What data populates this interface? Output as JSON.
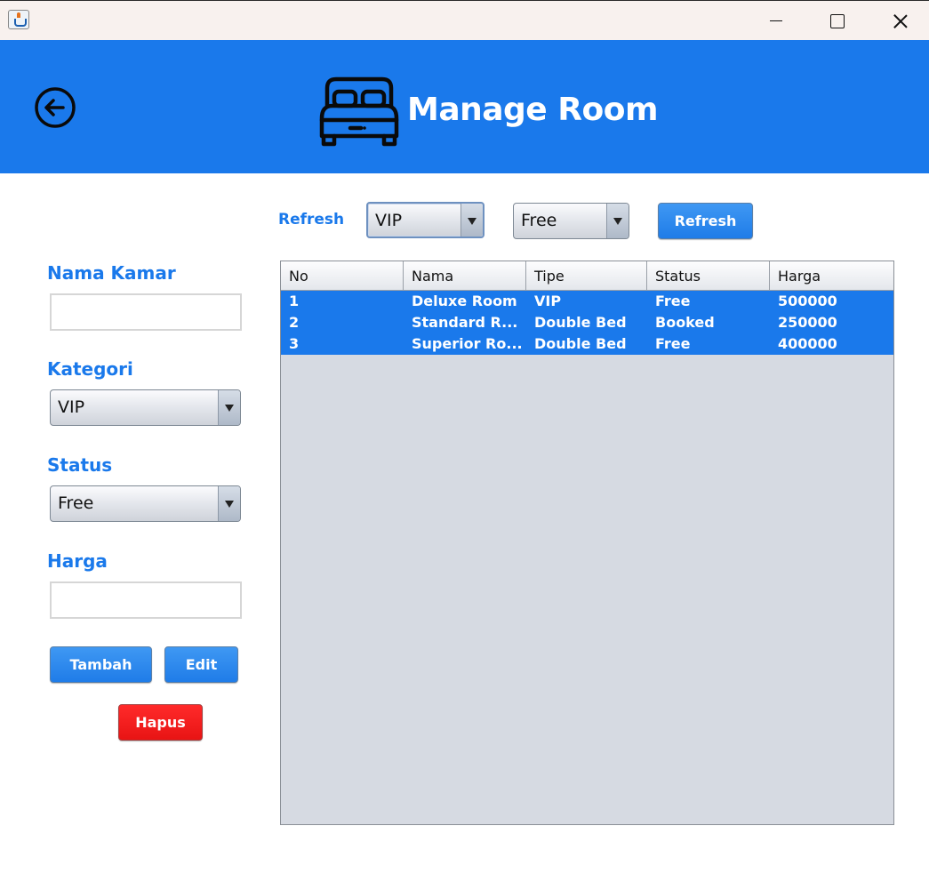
{
  "window": {
    "title": ""
  },
  "header": {
    "title": "Manage Room",
    "back_icon": "arrow-left-circle-icon",
    "bed_icon": "bed-icon"
  },
  "filters": {
    "label": "Refresh",
    "category_selected": "VIP",
    "status_selected": "Free",
    "refresh_button": "Refresh"
  },
  "form": {
    "nama_kamar_label": "Nama Kamar",
    "nama_kamar_value": "",
    "kategori_label": "Kategori",
    "kategori_selected": "VIP",
    "status_label": "Status",
    "status_selected": "Free",
    "harga_label": "Harga",
    "harga_value": "",
    "tambah_button": "Tambah",
    "edit_button": "Edit",
    "hapus_button": "Hapus"
  },
  "table": {
    "columns": [
      "No",
      "Nama",
      "Tipe",
      "Status",
      "Harga"
    ],
    "rows": [
      [
        "1",
        "Deluxe Room",
        "VIP",
        "Free",
        "500000"
      ],
      [
        "2",
        "Standard R...",
        "Double Bed",
        "Booked",
        "250000"
      ],
      [
        "3",
        "Superior Ro...",
        "Double Bed",
        "Free",
        "400000"
      ]
    ]
  },
  "colors": {
    "accent": "#1a79eb",
    "danger": "#e81414",
    "table_bg": "#d6dae2",
    "titlebar_bg": "#f8f1ee"
  }
}
